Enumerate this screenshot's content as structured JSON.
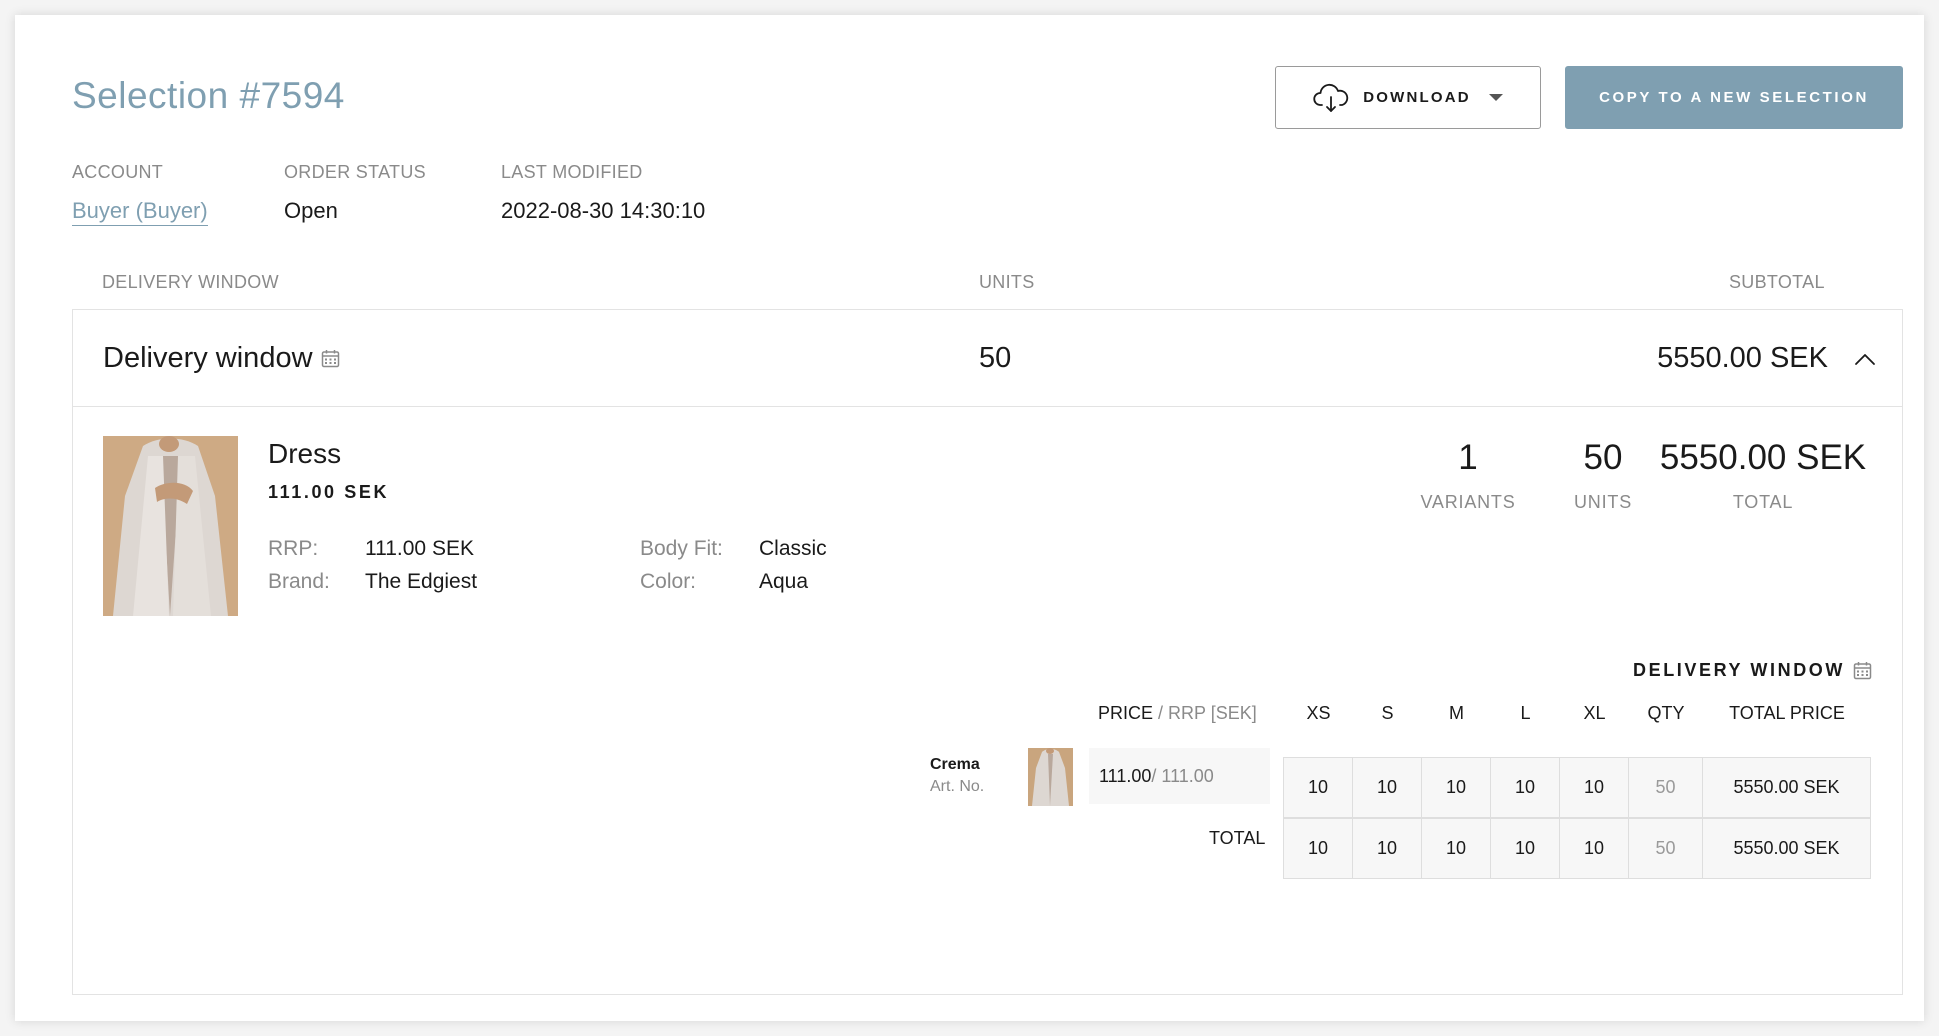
{
  "header": {
    "title": "Selection #7594",
    "download_label": "DOWNLOAD",
    "copy_label": "COPY TO A NEW SELECTION"
  },
  "meta": {
    "account_label": "ACCOUNT",
    "account_value": "Buyer (Buyer)",
    "status_label": "ORDER STATUS",
    "status_value": "Open",
    "modified_label": "LAST MODIFIED",
    "modified_value": "2022-08-30 14:30:10"
  },
  "columns": {
    "delivery_window": "DELIVERY WINDOW",
    "units": "UNITS",
    "subtotal": "SUBTOTAL"
  },
  "delivery_window": {
    "title": "Delivery window",
    "units": "50",
    "subtotal": "5550.00 SEK"
  },
  "product": {
    "name": "Dress",
    "price": "111.00 SEK",
    "rrp_label": "RRP:",
    "rrp_value": "111.00 SEK",
    "brand_label": "Brand:",
    "brand_value": "The Edgiest",
    "body_fit_label": "Body Fit:",
    "body_fit_value": "Classic",
    "color_label": "Color:",
    "color_value": "Aqua",
    "variants_count": "1",
    "variants_label": "VARIANTS",
    "units_count": "50",
    "units_label": "UNITS",
    "total_value": "5550.00 SEK",
    "total_label": "TOTAL"
  },
  "matrix": {
    "delivery_window_label": "DELIVERY WINDOW",
    "price_head": "PRICE",
    "rrp_head": " / RRP [SEK]",
    "sizes": [
      "XS",
      "S",
      "M",
      "L",
      "XL"
    ],
    "qty_head": "QTY",
    "total_price_head": "TOTAL PRICE",
    "variant": {
      "name": "Crema",
      "art_no": "Art. No.",
      "price": "111.00",
      "rrp": " / 111.00",
      "quantities": [
        "10",
        "10",
        "10",
        "10",
        "10"
      ],
      "qty": "50",
      "total_price": "5550.00 SEK"
    },
    "totals": {
      "label": "TOTAL",
      "quantities": [
        "10",
        "10",
        "10",
        "10",
        "10"
      ],
      "qty": "50",
      "total_price": "5550.00 SEK"
    }
  },
  "colors": {
    "accent": "#7f9fb1",
    "muted_text": "#8a8a8a",
    "border": "#e3e3e3"
  }
}
